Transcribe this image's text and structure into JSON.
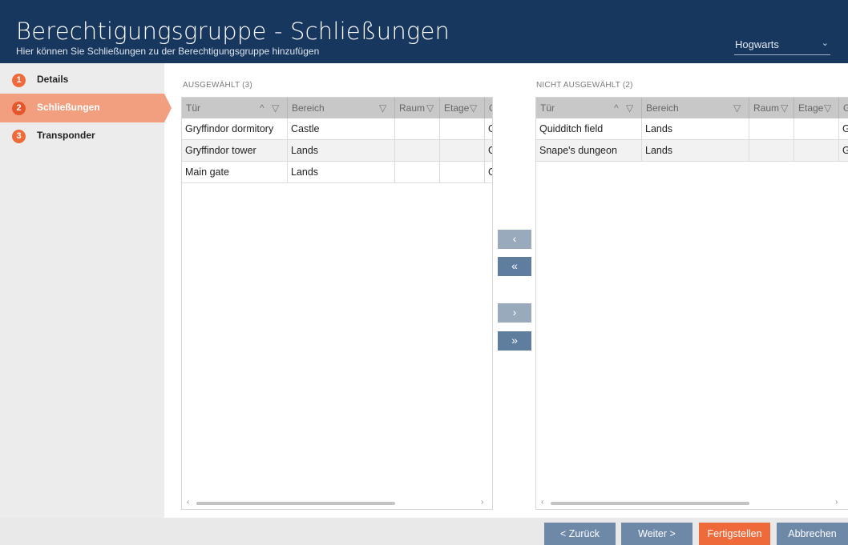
{
  "header": {
    "title": "Berechtigungsgruppe - Schließungen",
    "subtitle": "Hier können Sie Schließungen zu der Berechtigungsgruppe hinzufügen",
    "site": "Hogwarts"
  },
  "steps": [
    {
      "num": "1",
      "label": "Details"
    },
    {
      "num": "2",
      "label": "Schließungen"
    },
    {
      "num": "3",
      "label": "Transponder"
    }
  ],
  "selected": {
    "label": "AUSGEWÄHLT (3)",
    "columns": [
      "Tür",
      "Bereich",
      "Raum",
      "Etage",
      "G"
    ],
    "rows": [
      [
        "Gryffindor dormitory",
        "Castle",
        "",
        "",
        "G"
      ],
      [
        "Gryffindor tower",
        "Lands",
        "",
        "",
        "G"
      ],
      [
        "Main gate",
        "Lands",
        "",
        "",
        "G"
      ]
    ]
  },
  "not_selected": {
    "label": "NICHT AUSGEWÄHLT (2)",
    "columns": [
      "Tür",
      "Bereich",
      "Raum",
      "Etage",
      "G"
    ],
    "rows": [
      [
        "Quidditch field",
        "Lands",
        "",
        "",
        "G"
      ],
      [
        "Snape's dungeon",
        "Lands",
        "",
        "",
        "G"
      ]
    ]
  },
  "transfer": {
    "add_one": "‹",
    "add_all": "«",
    "remove_one": "›",
    "remove_all": "»"
  },
  "footer": {
    "back": "< Zurück",
    "next": "Weiter >",
    "finish": "Fertigstellen",
    "cancel": "Abbrechen"
  },
  "icons": {
    "sort_up": "^",
    "filter": "▽",
    "scroll_left": "‹",
    "scroll_right": "›",
    "dropdown": "⌄"
  },
  "colors": {
    "header_bg": "#17375e",
    "accent": "#ef6a3a",
    "active_step": "#f29f80",
    "button": "#6e88a8"
  }
}
